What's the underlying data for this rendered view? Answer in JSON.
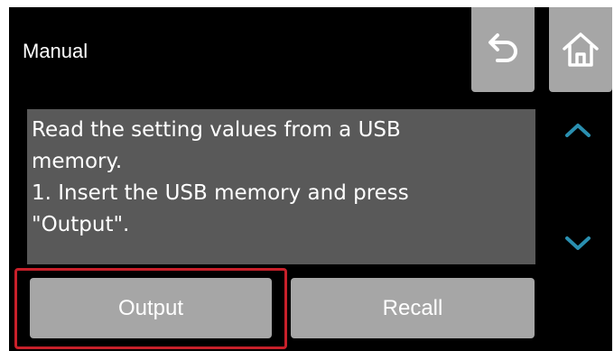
{
  "header": {
    "title": "Manual"
  },
  "toolbar": {
    "back_icon": "back-arrow-icon",
    "home_icon": "home-icon"
  },
  "message": {
    "text": "Read the setting values from a USB\nmemory.\n1. Insert the USB memory and press\n\"Output\"."
  },
  "scroll": {
    "up_icon": "chevron-up-icon",
    "down_icon": "chevron-down-icon"
  },
  "buttons": {
    "output_label": "Output",
    "recall_label": "Recall"
  },
  "colors": {
    "background": "#000000",
    "button": "#a6a6a6",
    "message_box": "#595959",
    "chevron": "#2a8fb0",
    "highlight": "#c8202a"
  }
}
